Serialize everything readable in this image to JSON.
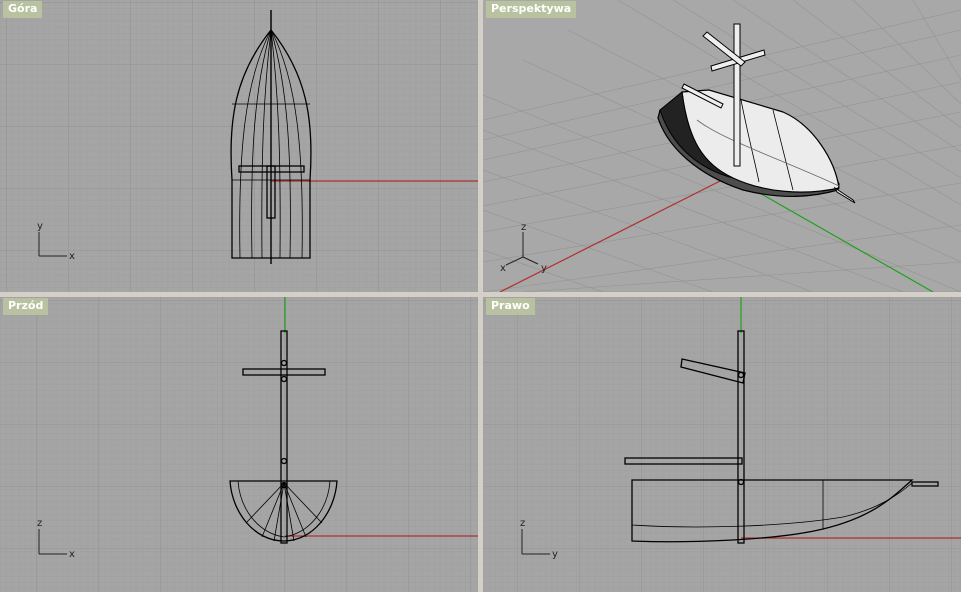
{
  "viewports": {
    "top": {
      "title": "Góra",
      "axis_a": "x",
      "axis_b": "y"
    },
    "perspective": {
      "title": "Perspektywa",
      "axis_a": "x",
      "axis_b": "y",
      "axis_c": "z"
    },
    "front": {
      "title": "Przód",
      "axis_a": "x",
      "axis_b": "z"
    },
    "right": {
      "title": "Prawo",
      "axis_a": "y",
      "axis_b": "z"
    }
  },
  "colors": {
    "viewport_bg": "#a5a5a5",
    "grid_minor": "#9c9c9c",
    "grid_major": "#8a8a8a",
    "x_axis": "#b03030",
    "y_axis": "#20a020",
    "title_bg": "#b9c2a0",
    "frame": "#d4d0c8"
  }
}
